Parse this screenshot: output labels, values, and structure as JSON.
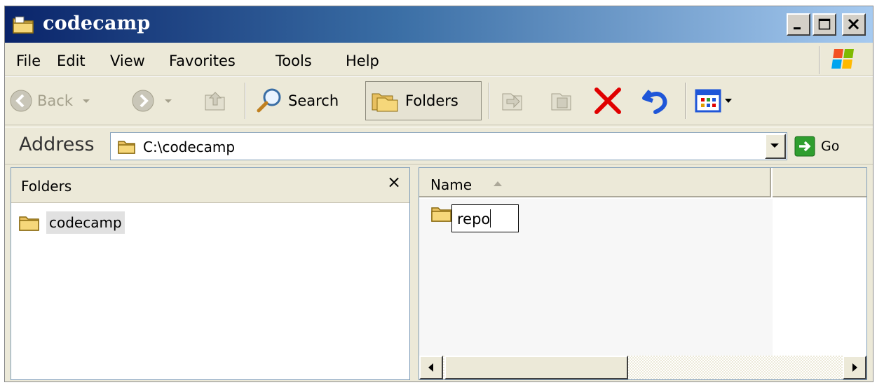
{
  "window": {
    "title": "codecamp"
  },
  "menu": {
    "items": [
      "File",
      "Edit",
      "View",
      "Favorites",
      "Tools",
      "Help"
    ]
  },
  "toolbar": {
    "back_label": "Back",
    "search_label": "Search",
    "folders_label": "Folders"
  },
  "address": {
    "label": "Address",
    "value": "C:\\codecamp",
    "go_label": "Go"
  },
  "folders_pane": {
    "title": "Folders",
    "close_symbol": "×",
    "items": [
      {
        "label": "codecamp",
        "icon": "folder-icon",
        "selected": true
      }
    ]
  },
  "file_list": {
    "columns": [
      "Name"
    ],
    "sort": "ascending",
    "items": [
      {
        "name": "repo",
        "icon": "folder-icon",
        "editing": true
      }
    ]
  },
  "colors": {
    "title_start": "#0a246a",
    "title_end": "#a6caf0",
    "chrome": "#ece9d8",
    "delete_red": "#e00000",
    "undo_blue": "#1f56d8",
    "go_green": "#2f9e2f"
  }
}
